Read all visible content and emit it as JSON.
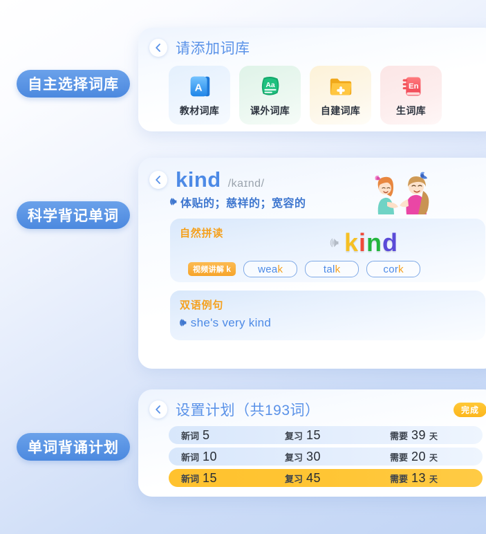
{
  "ribbons": [
    {
      "label": "自主选择词库"
    },
    {
      "label": "科学背记单词"
    },
    {
      "label": "单词背诵计划"
    }
  ],
  "card_dictionary": {
    "back_icon": "chevron-left-icon",
    "title": "请添加词库",
    "tiles": [
      {
        "label": "教材词库",
        "icon": "book-a-icon",
        "icon_letter": "A",
        "color": "#2f9cf4"
      },
      {
        "label": "课外词库",
        "icon": "book-aa-icon",
        "icon_letter": "Aa",
        "color": "#14a86b"
      },
      {
        "label": "自建词库",
        "icon": "folder-plus-icon",
        "icon_letter": "+",
        "color": "#f7b32b"
      },
      {
        "label": "生词库",
        "icon": "book-en-icon",
        "icon_letter": "En",
        "color": "#f2535a"
      }
    ]
  },
  "card_word": {
    "back_icon": "chevron-left-icon",
    "word": "kind",
    "phonetic": "/kaɪnd/",
    "speaker_icon": "speaker-icon",
    "meaning": "体贴的；慈祥的；宽容的",
    "illustration": "two-girls-illustration",
    "phonics": {
      "title": "自然拼读",
      "speaker_icon": "speaker-icon",
      "letters": [
        {
          "char": "k",
          "color": "#f6c024"
        },
        {
          "char": "i",
          "color": "#ef4a3a"
        },
        {
          "char": "n",
          "color": "#23b53d"
        },
        {
          "char": "d",
          "color": "#5a4bd8"
        }
      ],
      "video_tag": {
        "label": "视频讲解",
        "letter": "k"
      },
      "related": [
        {
          "prefix": "wea",
          "highlight": "k",
          "suffix": ""
        },
        {
          "prefix": "tal",
          "highlight": "k",
          "suffix": ""
        },
        {
          "prefix": "cor",
          "highlight": "k",
          "suffix": ""
        }
      ]
    },
    "example": {
      "title": "双语例句",
      "speaker_icon": "speaker-icon",
      "sentence": "she's very kind"
    }
  },
  "card_plan": {
    "back_icon": "chevron-left-icon",
    "title": "设置计划（共193词）",
    "done_badge": "完成",
    "columns": {
      "new": "新词",
      "review": "复习",
      "need": "需要",
      "day_unit": "天"
    },
    "rows": [
      {
        "new": "5",
        "review": "15",
        "need": "39",
        "active": false
      },
      {
        "new": "10",
        "review": "30",
        "need": "20",
        "active": false
      },
      {
        "new": "15",
        "review": "45",
        "need": "13",
        "active": true
      }
    ]
  }
}
